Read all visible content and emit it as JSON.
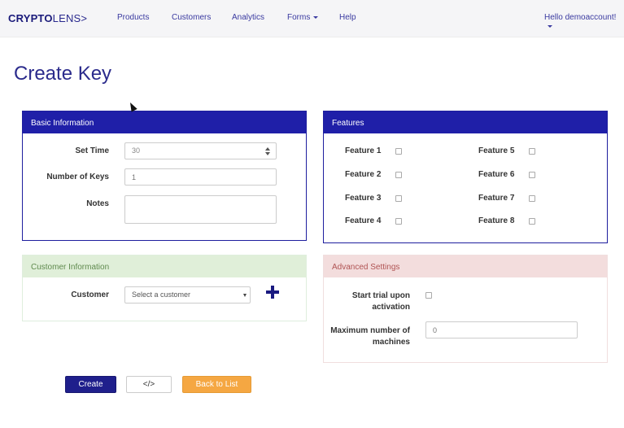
{
  "nav": {
    "brand_bold": "CRYPTO",
    "brand_rest": "LENS>",
    "links": [
      "Products",
      "Customers",
      "Analytics",
      "Forms",
      "Help"
    ],
    "user": "Hello demoaccount!"
  },
  "page": {
    "title": "Create Key"
  },
  "basic": {
    "heading": "Basic Information",
    "set_time_label": "Set Time",
    "set_time_value": "30",
    "num_keys_label": "Number of Keys",
    "num_keys_placeholder": "1",
    "notes_label": "Notes"
  },
  "features": {
    "heading": "Features",
    "items": [
      "Feature 1",
      "Feature 2",
      "Feature 3",
      "Feature 4",
      "Feature 5",
      "Feature 6",
      "Feature 7",
      "Feature 8"
    ]
  },
  "customer": {
    "heading": "Customer Information",
    "label": "Customer",
    "select_value": "Select a customer"
  },
  "advanced": {
    "heading": "Advanced Settings",
    "trial_label_1": "Start trial upon",
    "trial_label_2": "activation",
    "max_label_1": "Maximum number of",
    "max_label_2": "machines",
    "max_placeholder": "0"
  },
  "actions": {
    "create": "Create",
    "code": "</>",
    "back": "Back to List"
  },
  "colors": {
    "primary": "#1f1fa8",
    "success_bg": "#e0efd9",
    "danger_bg": "#f3dddd",
    "warning": "#f5a742"
  }
}
